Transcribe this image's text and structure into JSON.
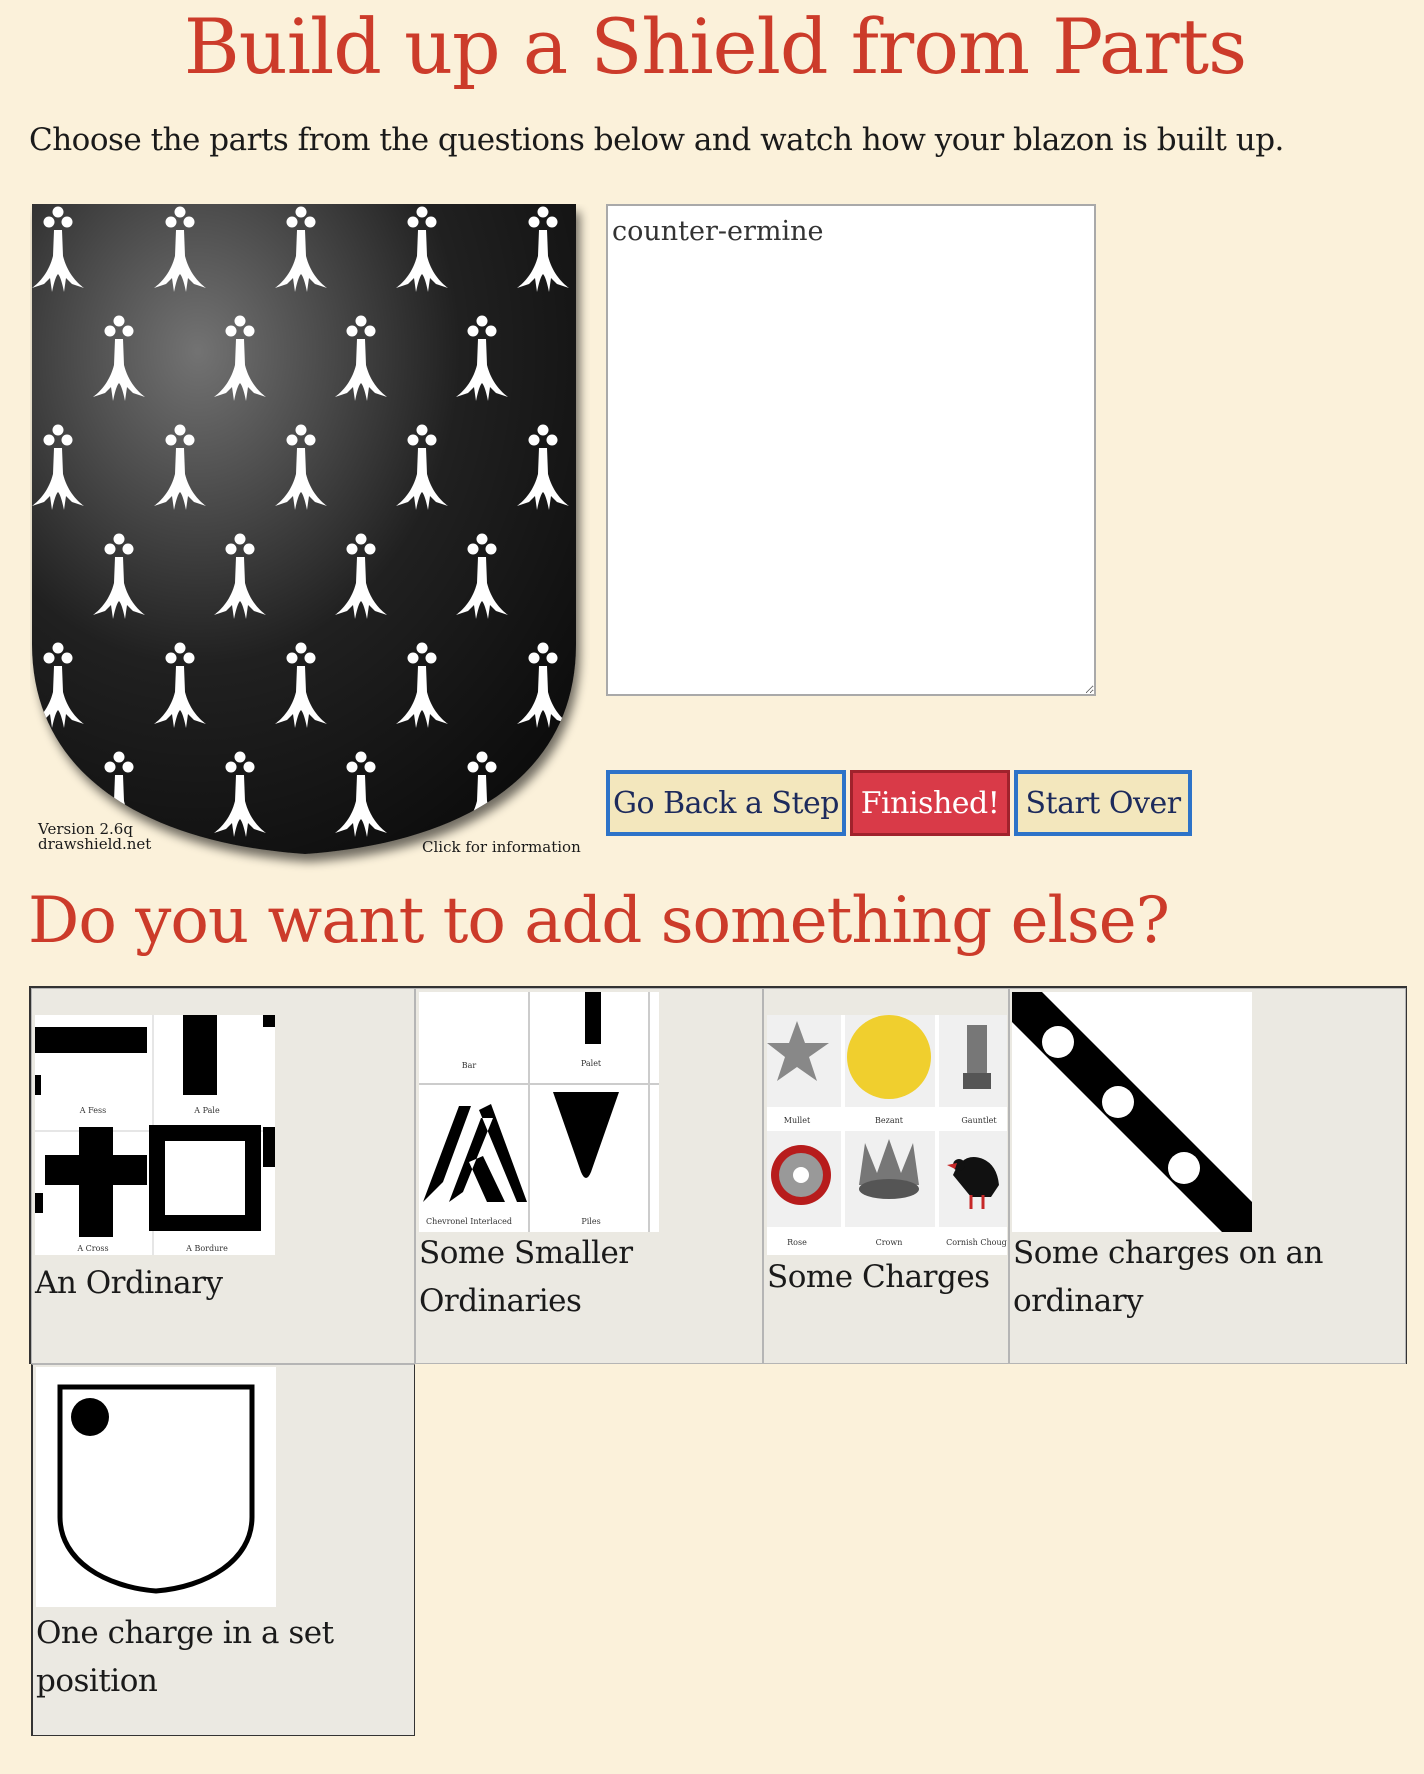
{
  "header": {
    "title": "Build up a Shield from Parts",
    "intro": "Choose the parts from the questions below and watch how your blazon is built up."
  },
  "shield": {
    "tincture": "counter-ermine",
    "field_color": "#111111",
    "spot_color": "#ffffff",
    "version_line1": "Version 2.6q",
    "version_line2": "drawshield.net",
    "info_link": "Click for information"
  },
  "blazon": {
    "value": "counter-ermine"
  },
  "buttons": {
    "back": "Go Back a Step",
    "finished": "Finished!",
    "start_over": "Start Over"
  },
  "options": {
    "heading": "Do you want to add something else?",
    "items": [
      {
        "label": "An Ordinary",
        "thumb_labels": [
          "A Fess",
          "A Pale",
          "A Cross",
          "A Bordure"
        ]
      },
      {
        "label": "Some Smaller Ordinaries",
        "thumb_labels": [
          "Bar",
          "Palet",
          "Chevronel Interlaced",
          "Piles"
        ]
      },
      {
        "label": "Some Charges",
        "thumb_labels": [
          "Mullet",
          "Bezant",
          "Gauntlet",
          "Rose",
          "Crown",
          "Cornish Chough"
        ]
      },
      {
        "label": "Some charges on an ordinary",
        "thumb_labels": []
      },
      {
        "label": "One charge in a set position",
        "thumb_labels": []
      }
    ]
  }
}
